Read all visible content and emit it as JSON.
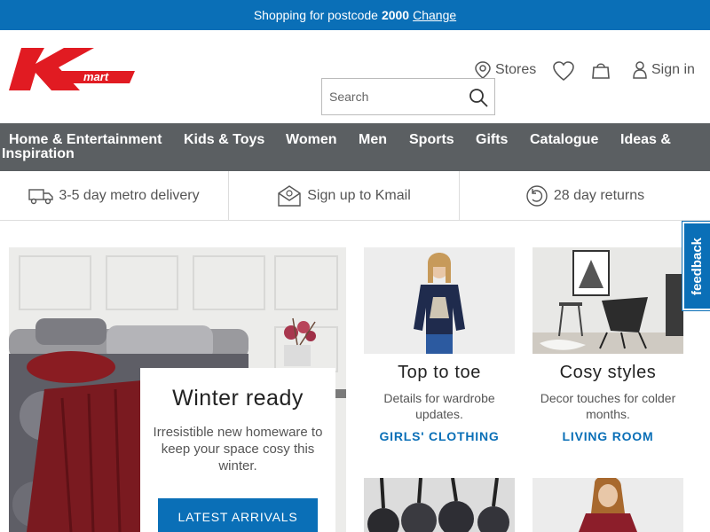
{
  "topbar": {
    "prefix": "Shopping for postcode",
    "postcode": "2000",
    "change_label": "Change"
  },
  "header": {
    "logo_text": "mart",
    "stores_label": "Stores",
    "signin_label": "Sign in",
    "search_placeholder": "Search"
  },
  "nav": {
    "items": [
      "Home & Entertainment",
      "Kids & Toys",
      "Women",
      "Men",
      "Sports",
      "Gifts",
      "Catalogue",
      "Ideas &",
      "Inspiration"
    ]
  },
  "benefits": [
    {
      "label": "3-5 day metro delivery",
      "icon": "truck-icon"
    },
    {
      "label": "Sign up to Kmail",
      "icon": "mail-icon"
    },
    {
      "label": "28 day returns",
      "icon": "returns-icon"
    }
  ],
  "hero": {
    "title": "Winter ready",
    "body": "Irresistible new homeware to keep your space cosy this winter.",
    "button_label": "LATEST ARRIVALS"
  },
  "tiles": [
    {
      "title": "Top to toe",
      "desc": "Details for wardrobe updates.",
      "link": "GIRLS' CLOTHING"
    },
    {
      "title": "Cosy styles",
      "desc": "Decor touches for colder months.",
      "link": "LIVING ROOM"
    }
  ],
  "feedback_label": "feedback",
  "colors": {
    "brand_blue": "#0a6fb7",
    "nav_gray": "#5b5f62",
    "kmart_red": "#e11b22"
  }
}
